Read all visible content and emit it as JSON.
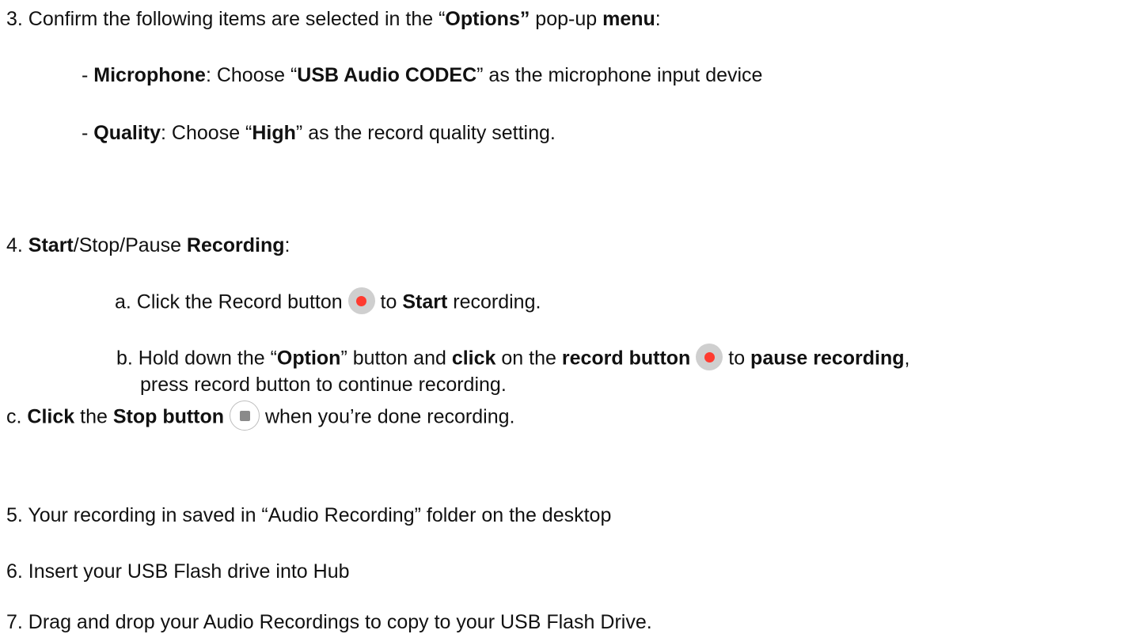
{
  "step3": {
    "a": "3. Confirm the following items are selected in the “",
    "b": "Options”",
    "c": " pop-up ",
    "d": "menu",
    "e": ":"
  },
  "mic": {
    "a": "- ",
    "b": "Microphone",
    "c": ": Choose “",
    "d": "USB Audio CODEC",
    "e": "” as the microphone input device"
  },
  "quality": {
    "a": "- ",
    "b": "Quality",
    "c": ": Choose “",
    "d": "High",
    "e": "” as the record quality setting."
  },
  "step4": {
    "a": "4. ",
    "b": "Start",
    "c": "/Stop/Pause ",
    "d": "Recording",
    "e": ":"
  },
  "step4a": {
    "a": "a. Click the Record button ",
    "b": " to ",
    "c": "Start",
    "d": " recording."
  },
  "step4b": {
    "a": "b. Hold down the “",
    "b": "Option",
    "c": "” button and ",
    "d": "click",
    "e": " on the ",
    "f": "record button",
    "g": " to ",
    "h": "pause recording",
    "i": ",",
    "cont": "press record button to continue recording."
  },
  "step4c": {
    "a": "c. ",
    "b": "Click",
    "c": " the ",
    "d": "Stop button",
    "e": " when you’re done recording."
  },
  "step5": "5. Your recording in saved in “Audio Recording” folder on the desktop",
  "step6": "6. Insert your USB Flash drive into Hub",
  "step7": "7. Drag and drop your Audio Recordings to copy to your USB Flash Drive.",
  "icons": {
    "record": "record-button-icon",
    "stop": "stop-button-icon"
  },
  "colors": {
    "record_dot": "#ff3b30",
    "button_face": "#cfcfcf",
    "stop_square": "#8a8a8a"
  }
}
